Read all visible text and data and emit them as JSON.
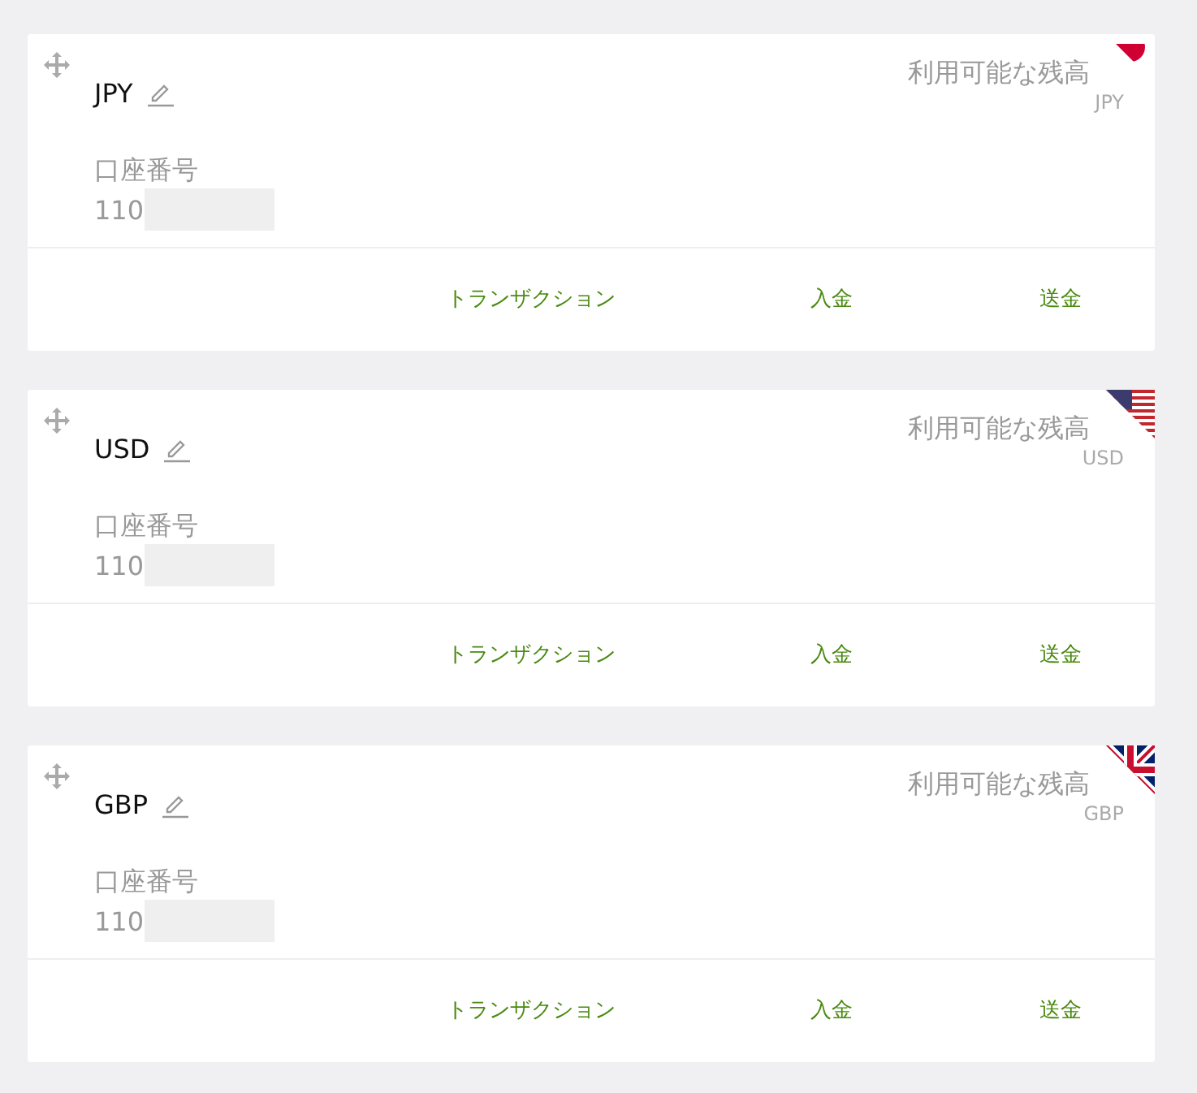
{
  "accounts": [
    {
      "currency": "JPY",
      "kind": "jp",
      "balance_label": "利用可能な残高",
      "balance_currency": "JPY",
      "account_label": "口座番号",
      "account_number": "110",
      "actions": [
        "トランザクション",
        "入金",
        "送金"
      ]
    },
    {
      "currency": "USD",
      "kind": "us",
      "balance_label": "利用可能な残高",
      "balance_currency": "USD",
      "account_label": "口座番号",
      "account_number": "110",
      "actions": [
        "トランザクション",
        "入金",
        "送金"
      ]
    },
    {
      "currency": "GBP",
      "kind": "gb",
      "balance_label": "利用可能な残高",
      "balance_currency": "GBP",
      "account_label": "口座番号",
      "account_number": "110",
      "actions": [
        "トランザクション",
        "入金",
        "送金"
      ]
    }
  ]
}
